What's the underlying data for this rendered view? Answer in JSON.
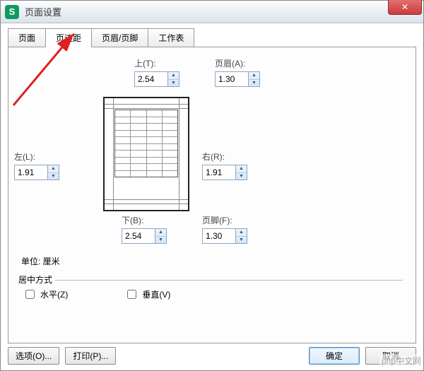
{
  "window": {
    "title": "页面设置",
    "app_icon_letter": "S"
  },
  "tabs": {
    "page": "页面",
    "margins": "页边距",
    "header_footer": "页眉/页脚",
    "sheet": "工作表"
  },
  "margins": {
    "top_label": "上(T):",
    "top_value": "2.54",
    "header_label": "页眉(A):",
    "header_value": "1.30",
    "left_label": "左(L):",
    "left_value": "1.91",
    "right_label": "右(R):",
    "right_value": "1.91",
    "bottom_label": "下(B):",
    "bottom_value": "2.54",
    "footer_label": "页脚(F):",
    "footer_value": "1.30",
    "unit_label": "单位: 厘米"
  },
  "center": {
    "legend": "居中方式",
    "horizontal": "水平(Z)",
    "vertical": "垂直(V)"
  },
  "buttons": {
    "options": "选项(O)...",
    "print": "打印(P)...",
    "ok": "确定",
    "cancel": "取消"
  },
  "watermark": "php中文网"
}
